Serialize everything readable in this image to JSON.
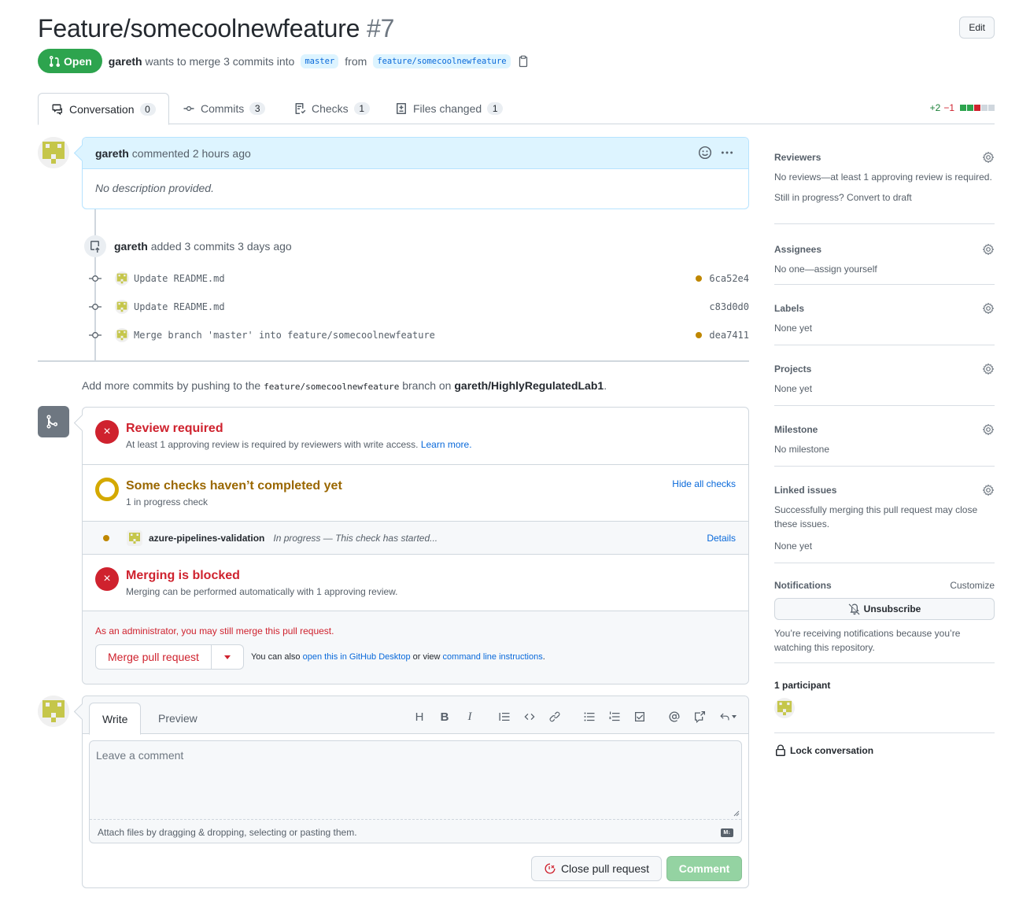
{
  "header": {
    "title": "Feature/somecoolnewfeature",
    "number": "#7",
    "edit_label": "Edit",
    "state": "Open",
    "author": "gareth",
    "merge_text_1": "wants to merge 3 commits into",
    "base_branch": "master",
    "merge_text_2": "from",
    "head_branch": "feature/somecoolnewfeature"
  },
  "tabs": [
    {
      "label": "Conversation",
      "count": "0",
      "icon": "comment-discussion-icon"
    },
    {
      "label": "Commits",
      "count": "3",
      "icon": "git-commit-icon"
    },
    {
      "label": "Checks",
      "count": "1",
      "icon": "checklist-icon"
    },
    {
      "label": "Files changed",
      "count": "1",
      "icon": "file-diff-icon"
    }
  ],
  "diffstat": {
    "additions": "+2",
    "deletions": "−1",
    "blocks": [
      "#2da44e",
      "#2da44e",
      "#cf222e",
      "#d0d7de",
      "#d0d7de"
    ]
  },
  "comment": {
    "author": "gareth",
    "action": "commented 2 hours ago",
    "body": "No description provided."
  },
  "push_event": {
    "author": "gareth",
    "text": "added 3 commits 3 days ago"
  },
  "commits": [
    {
      "message": "Update README.md",
      "sha": "6ca52e4",
      "status": "pending"
    },
    {
      "message": "Update README.md",
      "sha": "c83d0d0",
      "status": "none"
    },
    {
      "message": "Merge branch 'master' into feature/somecoolnewfeature",
      "sha": "dea7411",
      "status": "pending"
    }
  ],
  "push_hint": {
    "prefix": "Add more commits by pushing to the",
    "branch": "feature/somecoolnewfeature",
    "middle": "branch on",
    "repo": "gareth/HighlyRegulatedLab1",
    "suffix": "."
  },
  "merge_box": {
    "review": {
      "title": "Review required",
      "text": "At least 1 approving review is required by reviewers with write access.",
      "link": "Learn more."
    },
    "checks": {
      "title": "Some checks haven’t completed yet",
      "text": "1 in progress check",
      "toggle": "Hide all checks",
      "items": [
        {
          "name": "azure-pipelines-validation",
          "description": "In progress — This check has started...",
          "link": "Details"
        }
      ]
    },
    "blocked": {
      "title": "Merging is blocked",
      "text": "Merging can be performed automatically with 1 approving review."
    },
    "admin_note": "As an administrator, you may still merge this pull request.",
    "merge_button": "Merge pull request",
    "hint_prefix": "You can also",
    "hint_link1": "open this in GitHub Desktop",
    "hint_middle": "or view",
    "hint_link2": "command line instructions",
    "hint_suffix": "."
  },
  "editor": {
    "tab_write": "Write",
    "tab_preview": "Preview",
    "placeholder": "Leave a comment",
    "value": "",
    "attach_hint": "Attach files by dragging & dropping, selecting or pasting them.",
    "markdown_badge": "M↓",
    "close_button": "Close pull request",
    "comment_button": "Comment",
    "toolbar": [
      "heading-icon",
      "bold-icon",
      "italic-icon",
      "quote-icon",
      "code-icon",
      "link-icon",
      "unordered-list-icon",
      "ordered-list-icon",
      "task-list-icon",
      "mention-icon",
      "cross-reference-icon",
      "saved-replies-icon"
    ]
  },
  "sidebar": {
    "reviewers": {
      "title": "Reviewers",
      "text": "No reviews—at least 1 approving review is required.",
      "text2": "Still in progress? Convert to draft"
    },
    "assignees": {
      "title": "Assignees",
      "text": "No one—assign yourself"
    },
    "labels": {
      "title": "Labels",
      "text": "None yet"
    },
    "projects": {
      "title": "Projects",
      "text": "None yet"
    },
    "milestone": {
      "title": "Milestone",
      "text": "No milestone"
    },
    "linked_issues": {
      "title": "Linked issues",
      "text": "Successfully merging this pull request may close these issues.",
      "text2": "None yet"
    },
    "notifications": {
      "title": "Notifications",
      "customize": "Customize",
      "button": "Unsubscribe",
      "text": "You’re receiving notifications because you’re watching this repository."
    },
    "participants": {
      "title": "1 participant"
    },
    "lock": "Lock conversation"
  },
  "colors": {
    "open_green": "#2da44e",
    "danger_red": "#cf222e",
    "pending_yellow": "#bf8700",
    "link_blue": "#0969da",
    "avatar_olive": "#c5c64a"
  }
}
